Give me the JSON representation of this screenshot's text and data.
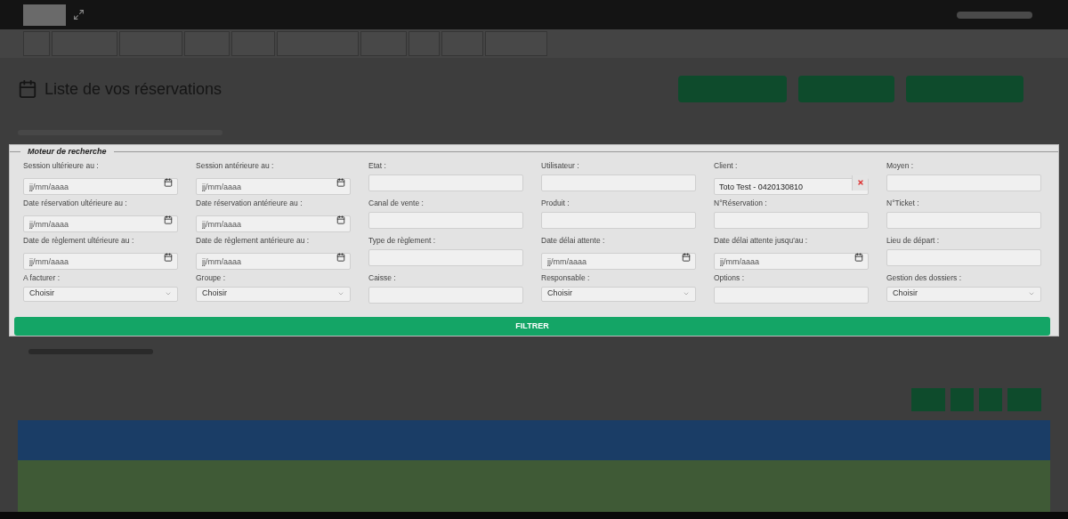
{
  "page": {
    "title": "Liste de vos réservations"
  },
  "search_panel": {
    "title": "Moteur de recherche",
    "fields": [
      {
        "kind": "date",
        "label": "Session ultérieure au :",
        "placeholder": "jj/mm/aaaa"
      },
      {
        "kind": "date",
        "label": "Session antérieure au :",
        "placeholder": "jj/mm/aaaa"
      },
      {
        "kind": "text",
        "label": "Etat :"
      },
      {
        "kind": "text",
        "label": "Utilisateur :"
      },
      {
        "kind": "client",
        "label": "Client :",
        "value": "Toto Test - 0420130810"
      },
      {
        "kind": "text",
        "label": "Moyen :"
      },
      {
        "kind": "date",
        "label": "Date réservation ultérieure au :",
        "placeholder": "jj/mm/aaaa"
      },
      {
        "kind": "date",
        "label": "Date réservation antérieure au :",
        "placeholder": "jj/mm/aaaa"
      },
      {
        "kind": "text",
        "label": "Canal de vente :"
      },
      {
        "kind": "text",
        "label": "Produit :"
      },
      {
        "kind": "text",
        "label": "N°Réservation :"
      },
      {
        "kind": "text",
        "label": "N°Ticket :"
      },
      {
        "kind": "date",
        "label": "Date de règlement ultérieure au :",
        "placeholder": "jj/mm/aaaa"
      },
      {
        "kind": "date",
        "label": "Date de règlement antérieure au :",
        "placeholder": "jj/mm/aaaa"
      },
      {
        "kind": "text",
        "label": "Type de règlement :"
      },
      {
        "kind": "date",
        "label": "Date délai attente :",
        "placeholder": "jj/mm/aaaa"
      },
      {
        "kind": "date",
        "label": "Date délai attente jusqu'au :",
        "placeholder": "jj/mm/aaaa"
      },
      {
        "kind": "text",
        "label": "Lieu de départ :"
      },
      {
        "kind": "select",
        "label": "A facturer :",
        "value": "Choisir"
      },
      {
        "kind": "select",
        "label": "Groupe :",
        "value": "Choisir"
      },
      {
        "kind": "text",
        "label": "Caisse :"
      },
      {
        "kind": "select",
        "label": "Responsable :",
        "value": "Choisir"
      },
      {
        "kind": "text",
        "label": "Options :"
      },
      {
        "kind": "select",
        "label": "Gestion des dossiers :",
        "value": "Choisir"
      }
    ],
    "filter_button": "FILTRER"
  }
}
